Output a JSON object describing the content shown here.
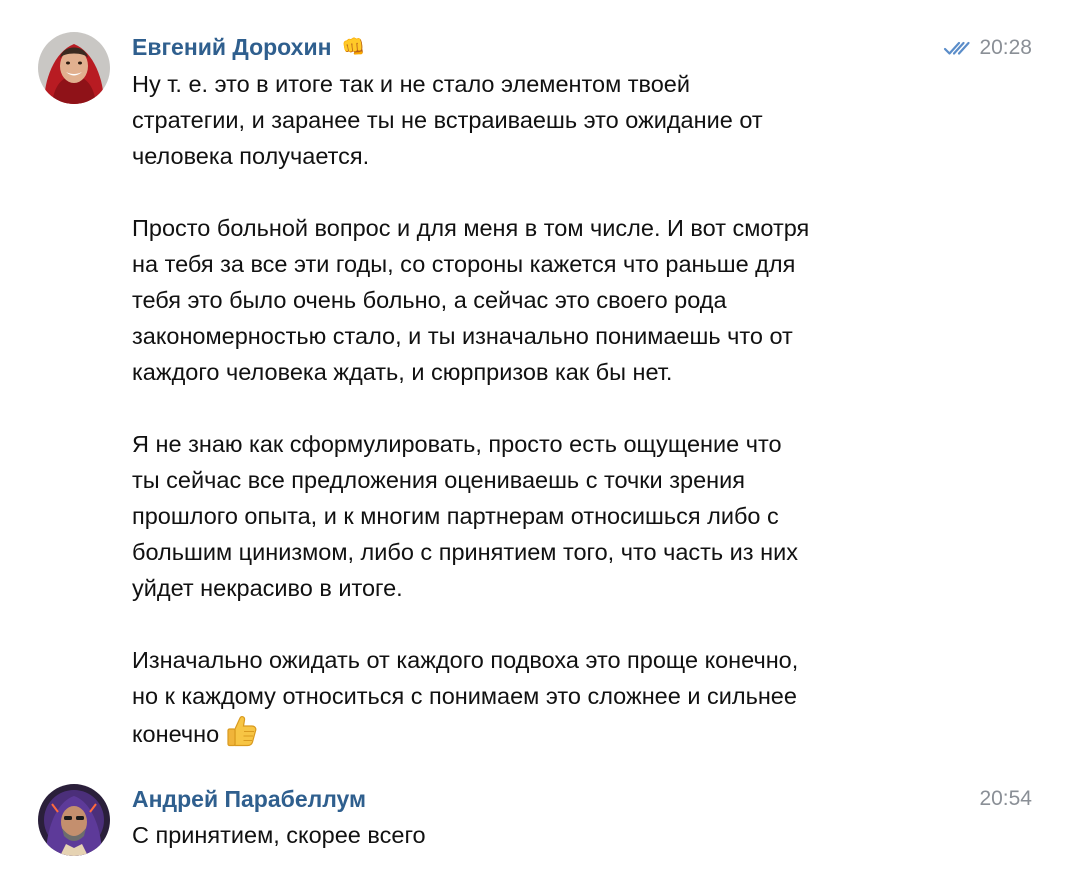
{
  "messages": [
    {
      "author": "Евгений Дорохин",
      "author_emoji": "👊",
      "author_emoji_icon": "fist-bump-icon",
      "time": "20:28",
      "read_status_icon": "double-check-icon",
      "paragraphs": [
        "Ну т. е. это в итоге так и не стало элементом твоей\nстратегии, и заранее ты не встраиваешь это ожидание от\nчеловека получается.",
        "Просто больной вопрос и для меня в том числе. И вот смотря\nна тебя за все эти годы, со стороны кажется что раньше для\nтебя это было очень больно, а сейчас это своего рода\nзакономерностью стало, и ты изначально понимаешь что от\nкаждого человека ждать, и сюрпризов как бы нет.",
        " Я не знаю как сформулировать, просто есть ощущение что\nты сейчас все предложения оцениваешь с точки зрения\nпрошлого опыта, и к многим партнерам относишься либо с\nбольшим цинизмом, либо с принятием того, что часть из них\nуйдет некрасиво в итоге.",
        "Изначально ожидать от каждого подвоха это проще конечно,\nно к каждому относиться с понимаем это сложнее и сильнее\nконечно"
      ],
      "trailing_emoji_icon": "thumbs-up-icon"
    },
    {
      "author": "Андрей Парабеллум",
      "time": "20:54",
      "paragraphs": [
        "С принятием, скорее всего"
      ]
    }
  ],
  "colors": {
    "author": "#2f5f8e",
    "time": "#8a8f96",
    "read_check": "#5b8dc9",
    "text": "#111111"
  }
}
